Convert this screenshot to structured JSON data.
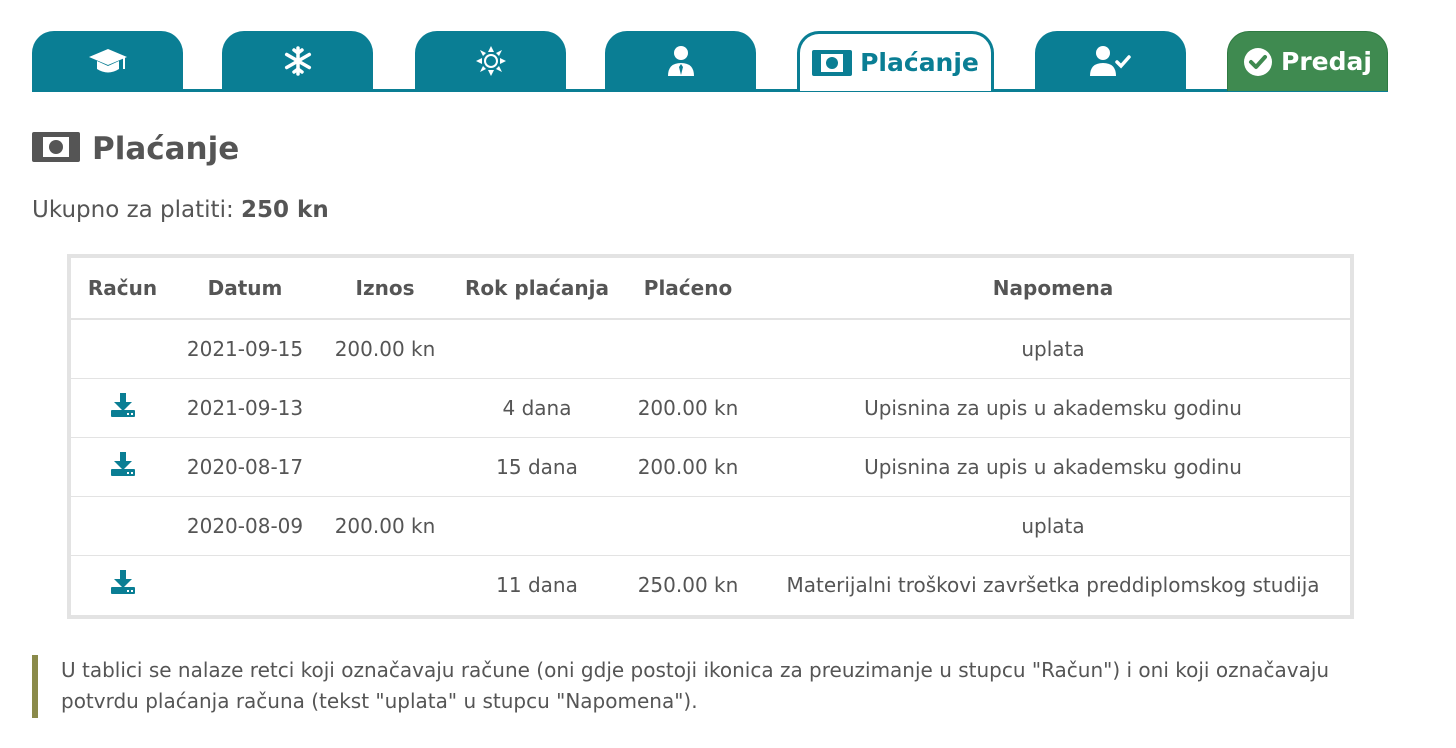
{
  "tabs": [
    {
      "icon": "graduation-cap-icon",
      "label": ""
    },
    {
      "icon": "snowflake-icon",
      "label": ""
    },
    {
      "icon": "sun-icon",
      "label": ""
    },
    {
      "icon": "user-tie-icon",
      "label": ""
    },
    {
      "icon": "money-bill-icon",
      "label": "Plaćanje",
      "active": true
    },
    {
      "icon": "user-check-icon",
      "label": ""
    },
    {
      "icon": "check-circle-icon",
      "label": "Predaj"
    }
  ],
  "page": {
    "title": "Plaćanje",
    "total_label": "Ukupno za platiti:",
    "total_value": "250 kn"
  },
  "table": {
    "headers": [
      "Račun",
      "Datum",
      "Iznos",
      "Rok plaćanja",
      "Plaćeno",
      "Napomena"
    ],
    "rows": [
      {
        "download": false,
        "datum": "2021-09-15",
        "iznos": "200.00 kn",
        "rok": "",
        "placeno": "",
        "napomena": "uplata"
      },
      {
        "download": true,
        "datum": "2021-09-13",
        "iznos": "",
        "rok": "4 dana",
        "placeno": "200.00 kn",
        "napomena": "Upisnina za upis u akademsku godinu"
      },
      {
        "download": true,
        "datum": "2020-08-17",
        "iznos": "",
        "rok": "15 dana",
        "placeno": "200.00 kn",
        "napomena": "Upisnina za upis u akademsku godinu"
      },
      {
        "download": false,
        "datum": "2020-08-09",
        "iznos": "200.00 kn",
        "rok": "",
        "placeno": "",
        "napomena": "uplata"
      },
      {
        "download": true,
        "datum": "",
        "iznos": "",
        "rok": "11 dana",
        "placeno": "250.00 kn",
        "napomena": "Materijalni troškovi završetka preddiplomskog studija"
      }
    ]
  },
  "note": {
    "line1": "U tablici se nalaze retci koji označavaju račune (oni gdje postoji ikonica za preuzimanje u stupcu \"Račun\") i oni koji označavaju",
    "line2": "potvrdu plaćanja računa (tekst \"uplata\" u stupcu \"Napomena\")."
  },
  "colors": {
    "accent": "#0a7e94",
    "submit": "#3f8a50",
    "note_border": "#8a8a4a"
  }
}
